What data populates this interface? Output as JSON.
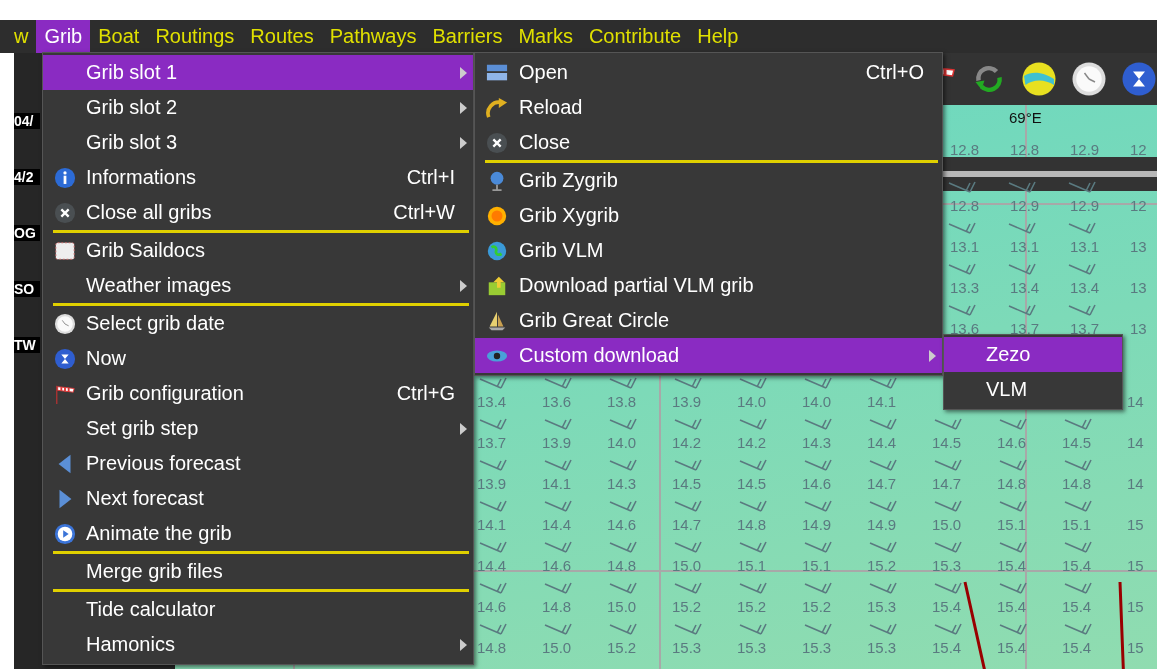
{
  "menubar": [
    {
      "label": "w",
      "selected": false
    },
    {
      "label": "Grib",
      "selected": true
    },
    {
      "label": "Boat",
      "selected": false
    },
    {
      "label": "Routings",
      "selected": false
    },
    {
      "label": "Routes",
      "selected": false
    },
    {
      "label": "Pathways",
      "selected": false
    },
    {
      "label": "Barriers",
      "selected": false
    },
    {
      "label": "Marks",
      "selected": false
    },
    {
      "label": "Contribute",
      "selected": false
    },
    {
      "label": "Help",
      "selected": false
    }
  ],
  "left_panel": {
    "labels": [
      {
        "text": "04/"
      },
      {
        "text": "4/2"
      },
      {
        "text": "OG"
      },
      {
        "text": "SO"
      },
      {
        "text": "TW"
      }
    ]
  },
  "toolbar": {
    "buttons": [
      {
        "kind": "windsock"
      },
      {
        "kind": "recycle"
      },
      {
        "kind": "windmap"
      },
      {
        "kind": "clock"
      },
      {
        "kind": "hourglass"
      }
    ]
  },
  "map": {
    "longitude_label": "69°E",
    "top_rows": [
      [
        "12.8",
        "12.8",
        "12.9",
        "12"
      ],
      [
        "12.8",
        "12.9",
        "12.9",
        "12"
      ],
      [
        "13.1",
        "13.1",
        "13.1",
        "13"
      ],
      [
        "13.3",
        "13.4",
        "13.4",
        "13"
      ],
      [
        "13.6",
        "13.7",
        "13.7",
        "13"
      ]
    ],
    "rows": [
      [
        "13.4",
        "13.6",
        "13.8",
        "13.9",
        "14.0",
        "14.0",
        "14.1",
        null,
        null,
        null,
        "14"
      ],
      [
        "13.7",
        "13.9",
        "14.0",
        "14.2",
        "14.2",
        "14.3",
        "14.4",
        "14.5",
        "14.6",
        "14.5",
        "14"
      ],
      [
        "13.9",
        "14.1",
        "14.3",
        "14.5",
        "14.5",
        "14.6",
        "14.7",
        "14.7",
        "14.8",
        "14.8",
        "14"
      ],
      [
        "14.1",
        "14.4",
        "14.6",
        "14.7",
        "14.8",
        "14.9",
        "14.9",
        "15.0",
        "15.1",
        "15.1",
        "15"
      ],
      [
        "14.4",
        "14.6",
        "14.8",
        "15.0",
        "15.1",
        "15.1",
        "15.2",
        "15.3",
        "15.4",
        "15.4",
        "15"
      ],
      [
        "14.6",
        "14.8",
        "15.0",
        "15.2",
        "15.2",
        "15.2",
        "15.3",
        "15.4",
        "15.4",
        "15.4",
        "15"
      ],
      [
        "14.8",
        "15.0",
        "15.2",
        "15.3",
        "15.3",
        "15.3",
        "15.3",
        "15.4",
        "15.4",
        "15.4",
        "15"
      ]
    ]
  },
  "grib_menu": [
    {
      "kind": "plain",
      "label": "Grib slot 1",
      "submenu": true,
      "selected": true
    },
    {
      "kind": "plain",
      "label": "Grib slot 2",
      "submenu": true,
      "selected": false
    },
    {
      "kind": "plain",
      "label": "Grib slot 3",
      "submenu": true,
      "selected": false
    },
    {
      "kind": "info",
      "label": "Informations",
      "shortcut": "Ctrl+I",
      "selected": false
    },
    {
      "kind": "close",
      "label": "Close all gribs",
      "shortcut": "Ctrl+W",
      "selected": false
    },
    {
      "kind": "separator"
    },
    {
      "kind": "envelope",
      "label": "Grib Saildocs",
      "selected": false
    },
    {
      "kind": "plain",
      "label": "Weather images",
      "submenu": true,
      "selected": false
    },
    {
      "kind": "separator"
    },
    {
      "kind": "clock",
      "label": "Select grib date",
      "selected": false
    },
    {
      "kind": "hourglass",
      "label": "Now",
      "selected": false
    },
    {
      "kind": "windsock",
      "label": "Grib configuration",
      "shortcut": "Ctrl+G",
      "selected": false
    },
    {
      "kind": "plain",
      "label": "Set grib step",
      "submenu": true,
      "selected": false
    },
    {
      "kind": "prev",
      "label": "Previous forecast",
      "selected": false
    },
    {
      "kind": "next",
      "label": "Next forecast",
      "selected": false
    },
    {
      "kind": "play",
      "label": "Animate the grib",
      "selected": false
    },
    {
      "kind": "separator"
    },
    {
      "kind": "plain",
      "label": "Merge grib files",
      "selected": false
    },
    {
      "kind": "separator"
    },
    {
      "kind": "plain",
      "label": "Tide calculator",
      "selected": false
    },
    {
      "kind": "plain",
      "label": "Hamonics",
      "submenu": true,
      "selected": false
    }
  ],
  "slot_menu": [
    {
      "kind": "folder",
      "label": "Open",
      "shortcut": "Ctrl+O",
      "selected": false
    },
    {
      "kind": "reload",
      "label": "Reload",
      "selected": false
    },
    {
      "kind": "close",
      "label": "Close",
      "selected": false
    },
    {
      "kind": "separator"
    },
    {
      "kind": "globe",
      "label": "Grib Zygrib",
      "selected": false
    },
    {
      "kind": "sun",
      "label": "Grib Xygrib",
      "selected": false
    },
    {
      "kind": "earth",
      "label": "Grib VLM",
      "selected": false
    },
    {
      "kind": "download",
      "label": "Download partial VLM grib",
      "selected": false
    },
    {
      "kind": "sailboat",
      "label": "Grib Great Circle",
      "selected": false
    },
    {
      "kind": "eye",
      "label": "Custom download",
      "submenu": true,
      "selected": true
    }
  ],
  "download_menu": [
    {
      "kind": "plain",
      "label": "Zezo",
      "selected": true
    },
    {
      "kind": "plain",
      "label": "VLM",
      "selected": false
    }
  ]
}
